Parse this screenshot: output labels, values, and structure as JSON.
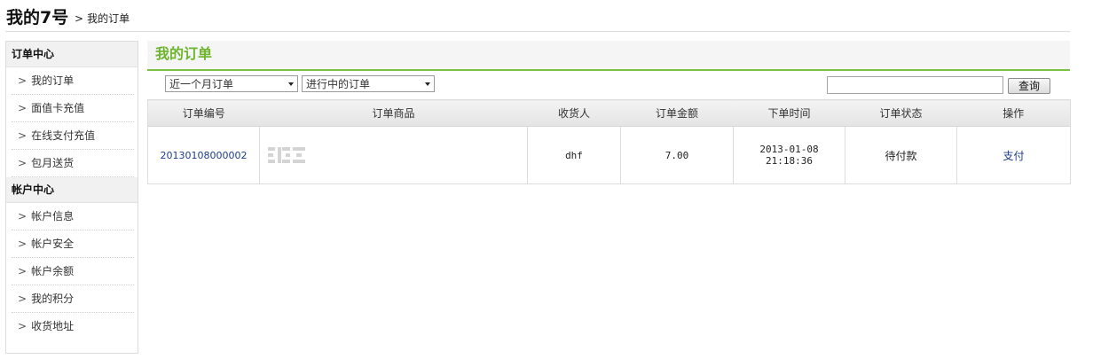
{
  "header": {
    "site_title": "我的7号",
    "breadcrumb_arrow": ">",
    "breadcrumb_current": "我的订单"
  },
  "sidebar": {
    "sections": [
      {
        "title": "订单中心",
        "items": [
          "我的订单",
          "面值卡充值",
          "在线支付充值",
          "包月送货"
        ]
      },
      {
        "title": "帐户中心",
        "items": [
          "帐户信息",
          "帐户安全",
          "帐户余额",
          "我的积分",
          "收货地址"
        ]
      }
    ],
    "item_prefix": ">"
  },
  "main": {
    "title": "我的订单",
    "accent_color": "#6cb52d",
    "filters": {
      "range_selected": "近一个月订单",
      "status_selected": "进行中的订单"
    },
    "search": {
      "value": "",
      "button_label": "查询"
    }
  },
  "table": {
    "headers": [
      "订单编号",
      "订单商品",
      "收货人",
      "订单金额",
      "下单时间",
      "订单状态",
      "操作"
    ],
    "rows": [
      {
        "order_no": "20130108000002",
        "goods_icon": "product-thumbnail-placeholder",
        "receiver": "dhf",
        "amount": "7.00",
        "date": "2013-01-08",
        "time": "21:18:36",
        "status": "待付款",
        "action": "支付"
      }
    ]
  }
}
